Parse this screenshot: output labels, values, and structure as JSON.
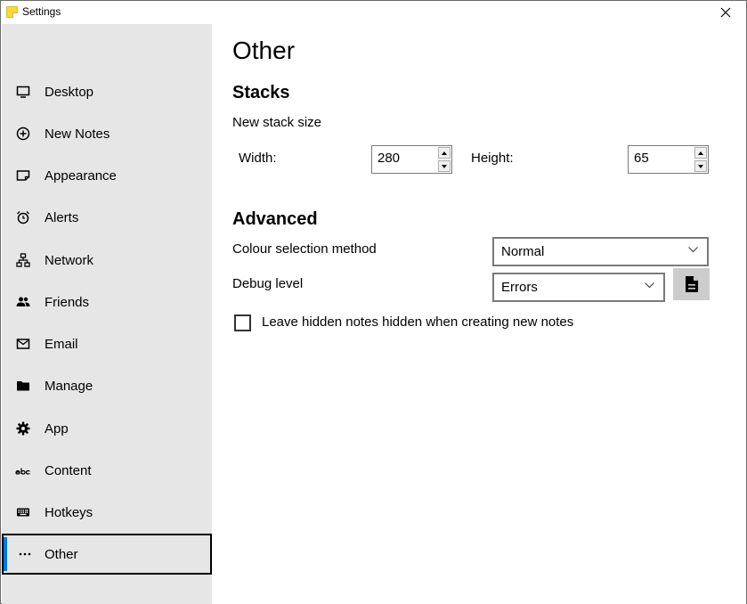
{
  "window": {
    "title": "Settings"
  },
  "sidebar": {
    "items": [
      {
        "label": "Desktop",
        "icon": "monitor-icon"
      },
      {
        "label": "New Notes",
        "icon": "plus-circle-icon"
      },
      {
        "label": "Appearance",
        "icon": "note-icon"
      },
      {
        "label": "Alerts",
        "icon": "alarm-clock-icon"
      },
      {
        "label": "Network",
        "icon": "network-icon"
      },
      {
        "label": "Friends",
        "icon": "people-icon"
      },
      {
        "label": "Email",
        "icon": "envelope-icon"
      },
      {
        "label": "Manage",
        "icon": "folder-icon"
      },
      {
        "label": "App",
        "icon": "gear-icon"
      },
      {
        "label": "Content",
        "icon": "abc-icon"
      },
      {
        "label": "Hotkeys",
        "icon": "keyboard-icon"
      },
      {
        "label": "Other",
        "icon": "ellipsis-icon",
        "selected": true
      }
    ]
  },
  "main": {
    "title": "Other",
    "stacks": {
      "heading": "Stacks",
      "subheading": "New stack size",
      "width_label": "Width:",
      "width_value": "280",
      "height_label": "Height:",
      "height_value": "65"
    },
    "advanced": {
      "heading": "Advanced",
      "colour_label": "Colour selection method",
      "colour_value": "Normal",
      "debug_label": "Debug level",
      "debug_value": "Errors"
    },
    "options": {
      "hidden_notes_label": "Leave hidden notes hidden when creating new notes",
      "hidden_notes_checked": false
    }
  },
  "colors": {
    "sidebar_bg": "#e6e6e6",
    "accent": "#0078d7",
    "button_bg": "#cccccc"
  }
}
